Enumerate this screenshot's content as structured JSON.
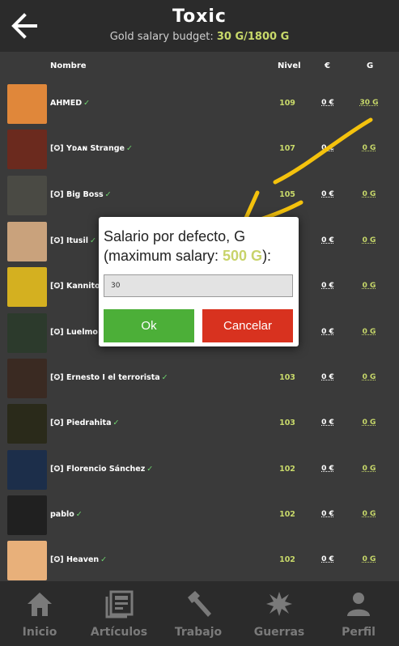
{
  "header": {
    "title": "Toxic",
    "subtitle_prefix": "Gold salary budget: ",
    "budget": "30 G/1800 G"
  },
  "columns": {
    "name": "Nombre",
    "level": "Nivel",
    "eur": "€",
    "gold": "G"
  },
  "rows": [
    {
      "guild": "",
      "name": "AHMED",
      "check": "✓",
      "level": "109",
      "eur": "0 €",
      "gold": "30 G"
    },
    {
      "guild": "[✪] ",
      "name": "Yᴅᴀɴ Strange",
      "check": "✓",
      "level": "107",
      "eur": "0 €",
      "gold": "0 G"
    },
    {
      "guild": "[✪] ",
      "name": "Big Boss",
      "check": "✓",
      "level": "105",
      "eur": "0 €",
      "gold": "0 G"
    },
    {
      "guild": "[✪] ",
      "name": "Itusil",
      "check": "✓",
      "level": "",
      "eur": "0 €",
      "gold": "0 G"
    },
    {
      "guild": "[✪] ",
      "name": "Kannito",
      "check": "",
      "level": "",
      "eur": "0 €",
      "gold": "0 G"
    },
    {
      "guild": "[✪] ",
      "name": "Luelmo",
      "check": "",
      "level": "",
      "eur": "0 €",
      "gold": "0 G"
    },
    {
      "guild": "[✪] ",
      "name": "Ernesto I el terrorista",
      "check": "✓",
      "level": "103",
      "eur": "0 €",
      "gold": "0 G"
    },
    {
      "guild": "[✪] ",
      "name": "Piedrahita",
      "check": "✓",
      "level": "103",
      "eur": "0 €",
      "gold": "0 G"
    },
    {
      "guild": "[✪] ",
      "name": "Florencio Sánchez",
      "check": "✓",
      "level": "102",
      "eur": "0 €",
      "gold": "0 G"
    },
    {
      "guild": "",
      "name": "pablo",
      "check": "✓",
      "level": "102",
      "eur": "0 €",
      "gold": "0 G"
    },
    {
      "guild": "[✪] ",
      "name": "Heaven",
      "check": "✓",
      "level": "102",
      "eur": "0 €",
      "gold": "0 G"
    }
  ],
  "dialog": {
    "text_1": "Salario por defecto, G",
    "text_2": "(maximum salary: ",
    "max_value": "500 G",
    "text_3": "):",
    "input_value": "30",
    "ok_label": "Ok",
    "cancel_label": "Cancelar"
  },
  "nav": [
    {
      "label": "Inicio",
      "icon": "home-icon"
    },
    {
      "label": "Artículos",
      "icon": "newspaper-icon"
    },
    {
      "label": "Trabajo",
      "icon": "hammer-icon"
    },
    {
      "label": "Guerras",
      "icon": "explosion-icon"
    },
    {
      "label": "Perfil",
      "icon": "person-icon"
    }
  ],
  "colors": {
    "accent_gold": "#c8d96a",
    "ok_green": "#4caf38",
    "cancel_red": "#d8321f",
    "annotation_yellow": "#f4c20d"
  }
}
